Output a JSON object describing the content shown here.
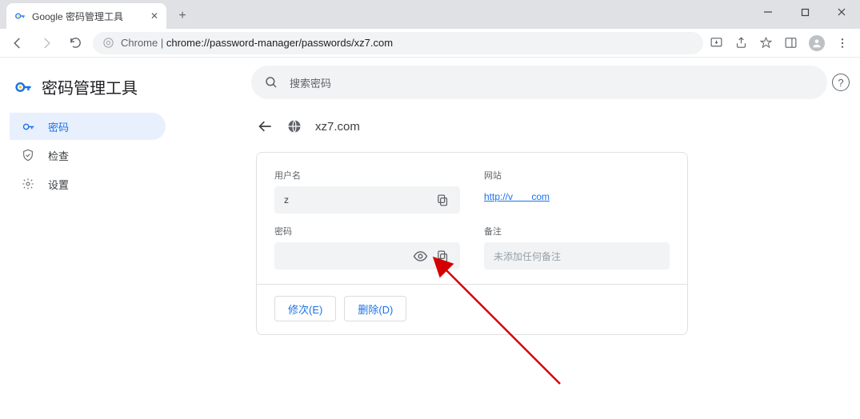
{
  "window": {
    "tab_title": "Google 密码管理工具"
  },
  "toolbar": {
    "url_prefix": "Chrome",
    "url_sep": " | ",
    "url_path": "chrome://password-manager/passwords/xz7.com"
  },
  "sidebar": {
    "title": "密码管理工具",
    "items": [
      {
        "label": "密码"
      },
      {
        "label": "检查"
      },
      {
        "label": "设置"
      }
    ]
  },
  "search": {
    "placeholder": "搜索密码"
  },
  "detail": {
    "site_title": "xz7.com",
    "username_label": "用户名",
    "username_value": "z",
    "password_label": "密码",
    "password_value": "",
    "website_label": "网站",
    "website_link_prefix": "http://v",
    "website_link_suffix": "com",
    "note_label": "备注",
    "note_placeholder": "未添加任何备注",
    "edit_button": "修次(E)",
    "delete_button": "删除(D)"
  }
}
